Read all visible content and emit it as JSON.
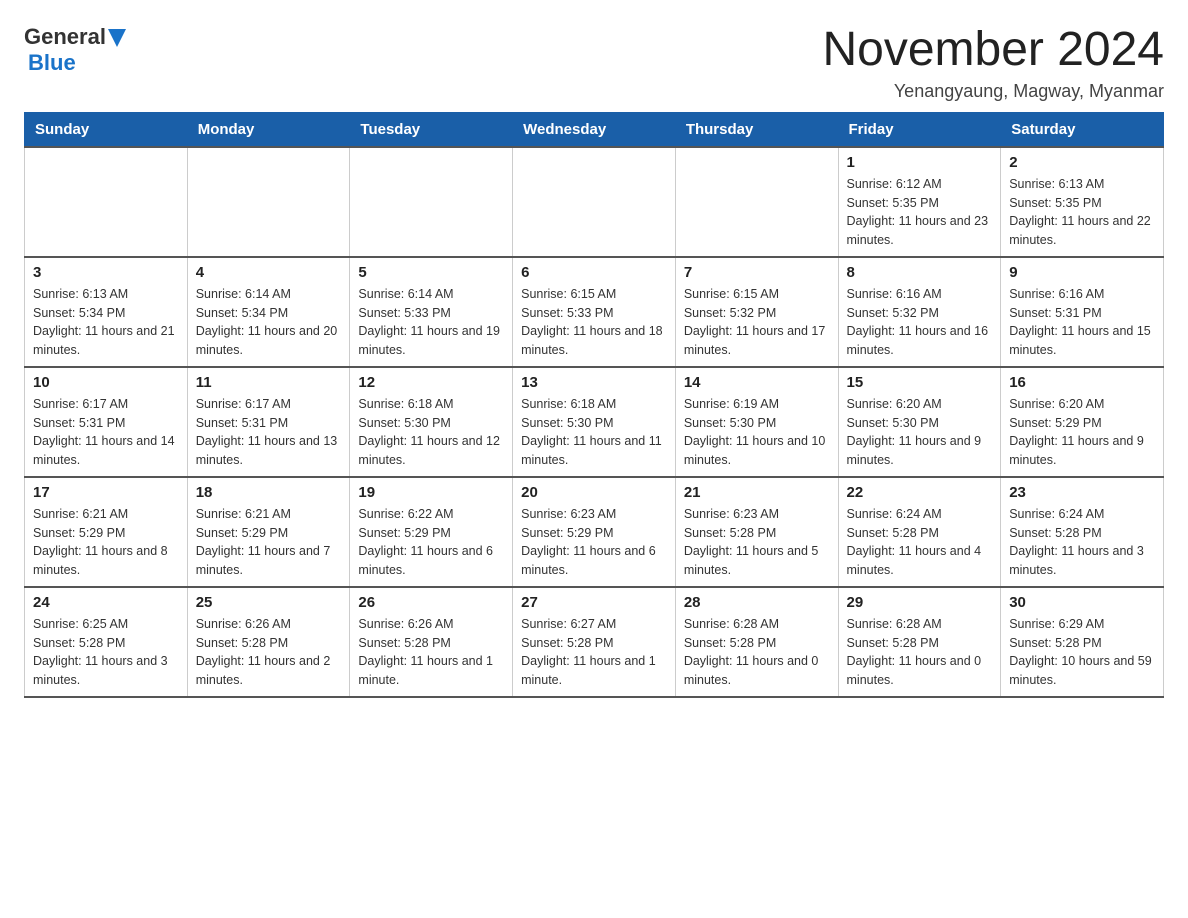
{
  "header": {
    "logo": {
      "general": "General",
      "blue": "Blue"
    },
    "title": "November 2024",
    "subtitle": "Yenangyaung, Magway, Myanmar"
  },
  "calendar": {
    "headers": [
      "Sunday",
      "Monday",
      "Tuesday",
      "Wednesday",
      "Thursday",
      "Friday",
      "Saturday"
    ],
    "weeks": [
      [
        {
          "day": "",
          "info": ""
        },
        {
          "day": "",
          "info": ""
        },
        {
          "day": "",
          "info": ""
        },
        {
          "day": "",
          "info": ""
        },
        {
          "day": "",
          "info": ""
        },
        {
          "day": "1",
          "info": "Sunrise: 6:12 AM\nSunset: 5:35 PM\nDaylight: 11 hours and 23 minutes."
        },
        {
          "day": "2",
          "info": "Sunrise: 6:13 AM\nSunset: 5:35 PM\nDaylight: 11 hours and 22 minutes."
        }
      ],
      [
        {
          "day": "3",
          "info": "Sunrise: 6:13 AM\nSunset: 5:34 PM\nDaylight: 11 hours and 21 minutes."
        },
        {
          "day": "4",
          "info": "Sunrise: 6:14 AM\nSunset: 5:34 PM\nDaylight: 11 hours and 20 minutes."
        },
        {
          "day": "5",
          "info": "Sunrise: 6:14 AM\nSunset: 5:33 PM\nDaylight: 11 hours and 19 minutes."
        },
        {
          "day": "6",
          "info": "Sunrise: 6:15 AM\nSunset: 5:33 PM\nDaylight: 11 hours and 18 minutes."
        },
        {
          "day": "7",
          "info": "Sunrise: 6:15 AM\nSunset: 5:32 PM\nDaylight: 11 hours and 17 minutes."
        },
        {
          "day": "8",
          "info": "Sunrise: 6:16 AM\nSunset: 5:32 PM\nDaylight: 11 hours and 16 minutes."
        },
        {
          "day": "9",
          "info": "Sunrise: 6:16 AM\nSunset: 5:31 PM\nDaylight: 11 hours and 15 minutes."
        }
      ],
      [
        {
          "day": "10",
          "info": "Sunrise: 6:17 AM\nSunset: 5:31 PM\nDaylight: 11 hours and 14 minutes."
        },
        {
          "day": "11",
          "info": "Sunrise: 6:17 AM\nSunset: 5:31 PM\nDaylight: 11 hours and 13 minutes."
        },
        {
          "day": "12",
          "info": "Sunrise: 6:18 AM\nSunset: 5:30 PM\nDaylight: 11 hours and 12 minutes."
        },
        {
          "day": "13",
          "info": "Sunrise: 6:18 AM\nSunset: 5:30 PM\nDaylight: 11 hours and 11 minutes."
        },
        {
          "day": "14",
          "info": "Sunrise: 6:19 AM\nSunset: 5:30 PM\nDaylight: 11 hours and 10 minutes."
        },
        {
          "day": "15",
          "info": "Sunrise: 6:20 AM\nSunset: 5:30 PM\nDaylight: 11 hours and 9 minutes."
        },
        {
          "day": "16",
          "info": "Sunrise: 6:20 AM\nSunset: 5:29 PM\nDaylight: 11 hours and 9 minutes."
        }
      ],
      [
        {
          "day": "17",
          "info": "Sunrise: 6:21 AM\nSunset: 5:29 PM\nDaylight: 11 hours and 8 minutes."
        },
        {
          "day": "18",
          "info": "Sunrise: 6:21 AM\nSunset: 5:29 PM\nDaylight: 11 hours and 7 minutes."
        },
        {
          "day": "19",
          "info": "Sunrise: 6:22 AM\nSunset: 5:29 PM\nDaylight: 11 hours and 6 minutes."
        },
        {
          "day": "20",
          "info": "Sunrise: 6:23 AM\nSunset: 5:29 PM\nDaylight: 11 hours and 6 minutes."
        },
        {
          "day": "21",
          "info": "Sunrise: 6:23 AM\nSunset: 5:28 PM\nDaylight: 11 hours and 5 minutes."
        },
        {
          "day": "22",
          "info": "Sunrise: 6:24 AM\nSunset: 5:28 PM\nDaylight: 11 hours and 4 minutes."
        },
        {
          "day": "23",
          "info": "Sunrise: 6:24 AM\nSunset: 5:28 PM\nDaylight: 11 hours and 3 minutes."
        }
      ],
      [
        {
          "day": "24",
          "info": "Sunrise: 6:25 AM\nSunset: 5:28 PM\nDaylight: 11 hours and 3 minutes."
        },
        {
          "day": "25",
          "info": "Sunrise: 6:26 AM\nSunset: 5:28 PM\nDaylight: 11 hours and 2 minutes."
        },
        {
          "day": "26",
          "info": "Sunrise: 6:26 AM\nSunset: 5:28 PM\nDaylight: 11 hours and 1 minute."
        },
        {
          "day": "27",
          "info": "Sunrise: 6:27 AM\nSunset: 5:28 PM\nDaylight: 11 hours and 1 minute."
        },
        {
          "day": "28",
          "info": "Sunrise: 6:28 AM\nSunset: 5:28 PM\nDaylight: 11 hours and 0 minutes."
        },
        {
          "day": "29",
          "info": "Sunrise: 6:28 AM\nSunset: 5:28 PM\nDaylight: 11 hours and 0 minutes."
        },
        {
          "day": "30",
          "info": "Sunrise: 6:29 AM\nSunset: 5:28 PM\nDaylight: 10 hours and 59 minutes."
        }
      ]
    ]
  }
}
